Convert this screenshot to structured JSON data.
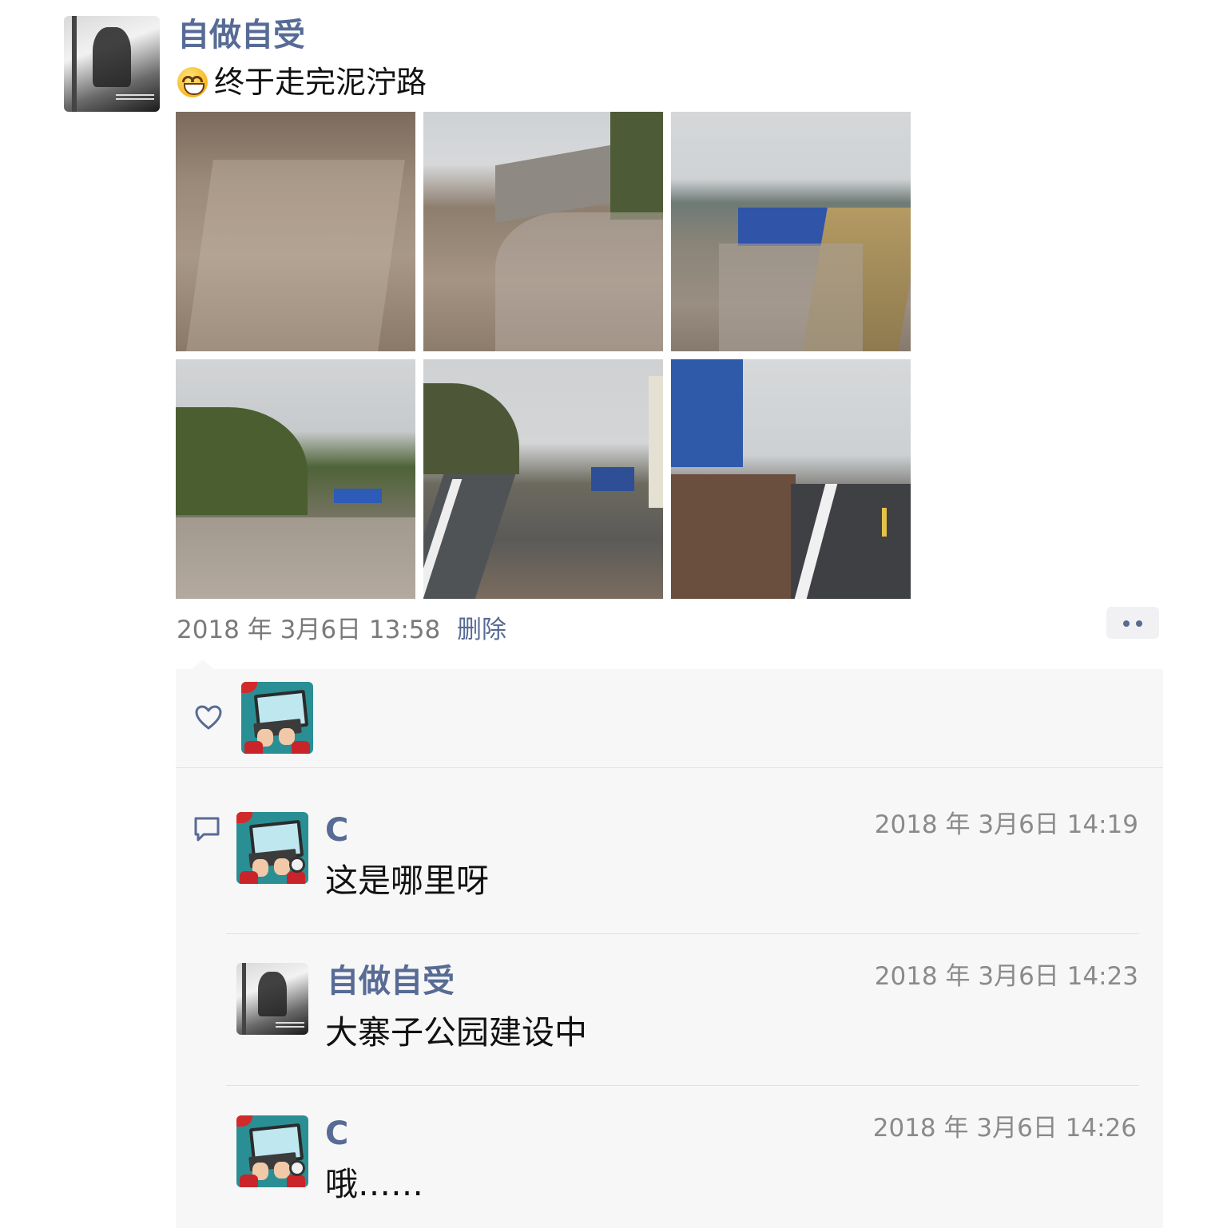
{
  "post": {
    "author": "自做自受",
    "emoji": "grinning-face-emoji",
    "text": "终于走完泥泞路",
    "photo_count": 6,
    "timestamp": "2018 年 3月6日 13:58",
    "delete_label": "删除",
    "more_icon": "more-dots-icon"
  },
  "likes": {
    "icon": "heart-icon",
    "users": [
      "C"
    ]
  },
  "comments": [
    {
      "author": "C",
      "time": "2018 年 3月6日 14:19",
      "text": "这是哪里呀"
    },
    {
      "author": "自做自受",
      "time": "2018 年 3月6日 14:23",
      "text": "大寨子公园建设中"
    },
    {
      "author": "C",
      "time": "2018 年 3月6日 14:26",
      "text": "哦……"
    }
  ],
  "colors": {
    "link": "#576b95",
    "panel_bg": "#f7f7f7",
    "meta_text": "#7a7a7a"
  }
}
